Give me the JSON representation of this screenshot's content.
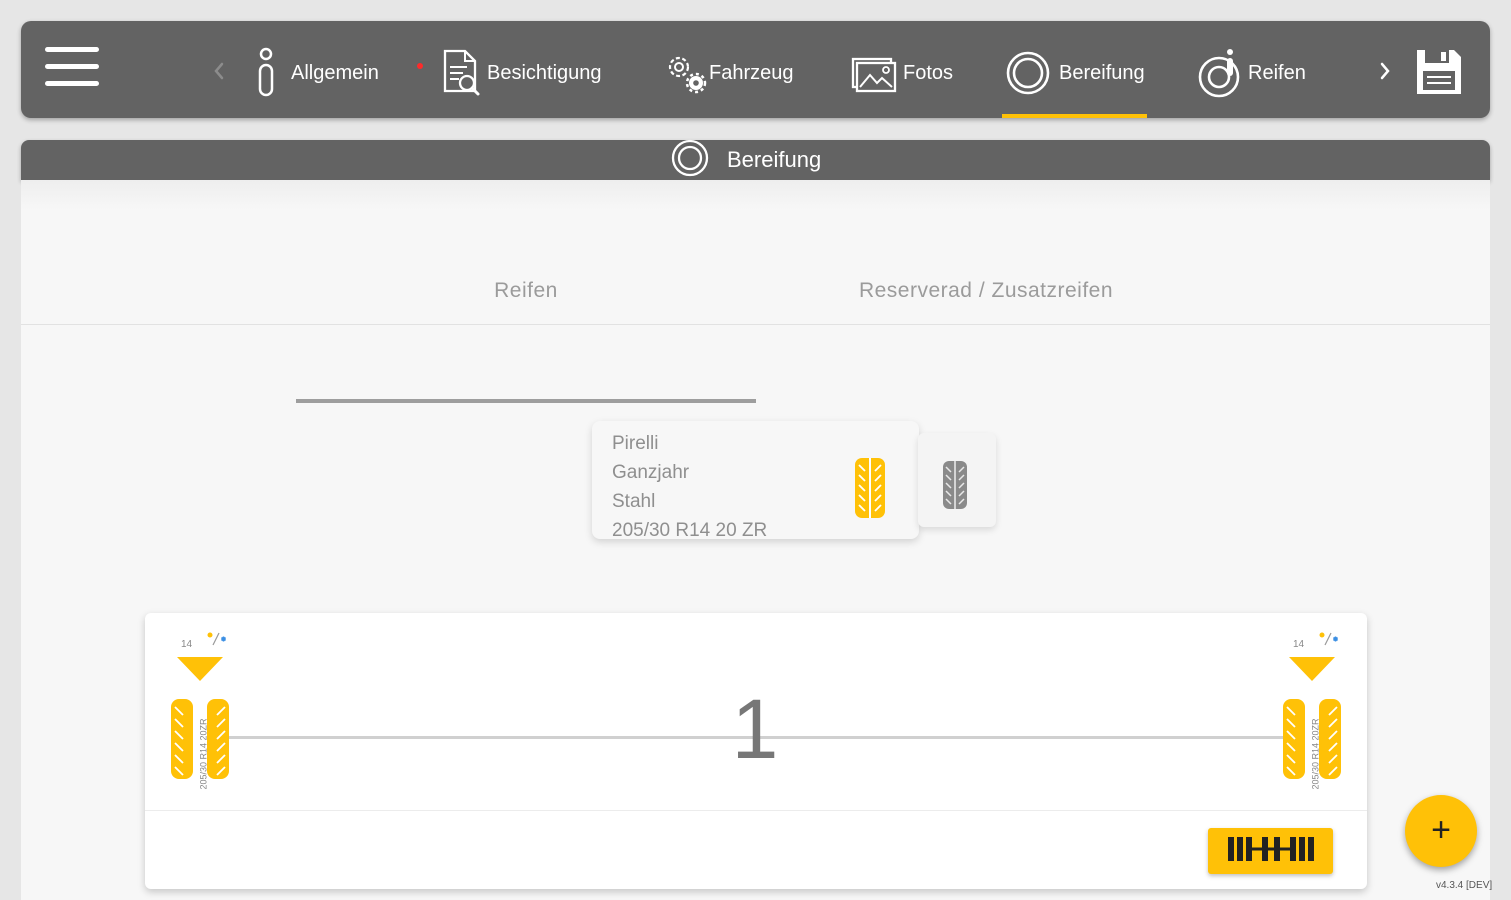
{
  "topbar": {
    "tabs": [
      {
        "label": "Allgemein",
        "icon": "info-icon",
        "required": true
      },
      {
        "label": "Besichtigung",
        "icon": "inspection-document-icon"
      },
      {
        "label": "Fahrzeug",
        "icon": "gears-icon"
      },
      {
        "label": "Fotos",
        "icon": "photos-icon"
      },
      {
        "label": "Bereifung",
        "icon": "tire-ring-icon",
        "active": true
      },
      {
        "label": "Reifen",
        "icon": "tire-info-icon"
      }
    ],
    "accent_color": "#ffc107",
    "required_dot_color": "#ff2a2a"
  },
  "section": {
    "title": "Bereifung",
    "icon": "tire-ring-icon"
  },
  "subtabs": [
    {
      "label": "Reifen",
      "active": true
    },
    {
      "label": "Reserverad / Zusatzreifen",
      "active": false
    }
  ],
  "tire_card": {
    "brand": "Pirelli",
    "season": "Ganzjahr",
    "rim": "Stahl",
    "size": "205/30 R14 20 ZR"
  },
  "axle": {
    "number": "1",
    "left_wheel": {
      "rim_size": "14",
      "spec": "205/30 R14 20ZR"
    },
    "right_wheel": {
      "rim_size": "14",
      "spec": "205/30 R14 20ZR"
    }
  },
  "fab": {
    "label": "+"
  },
  "version": "v4.3.4 [DEV]"
}
